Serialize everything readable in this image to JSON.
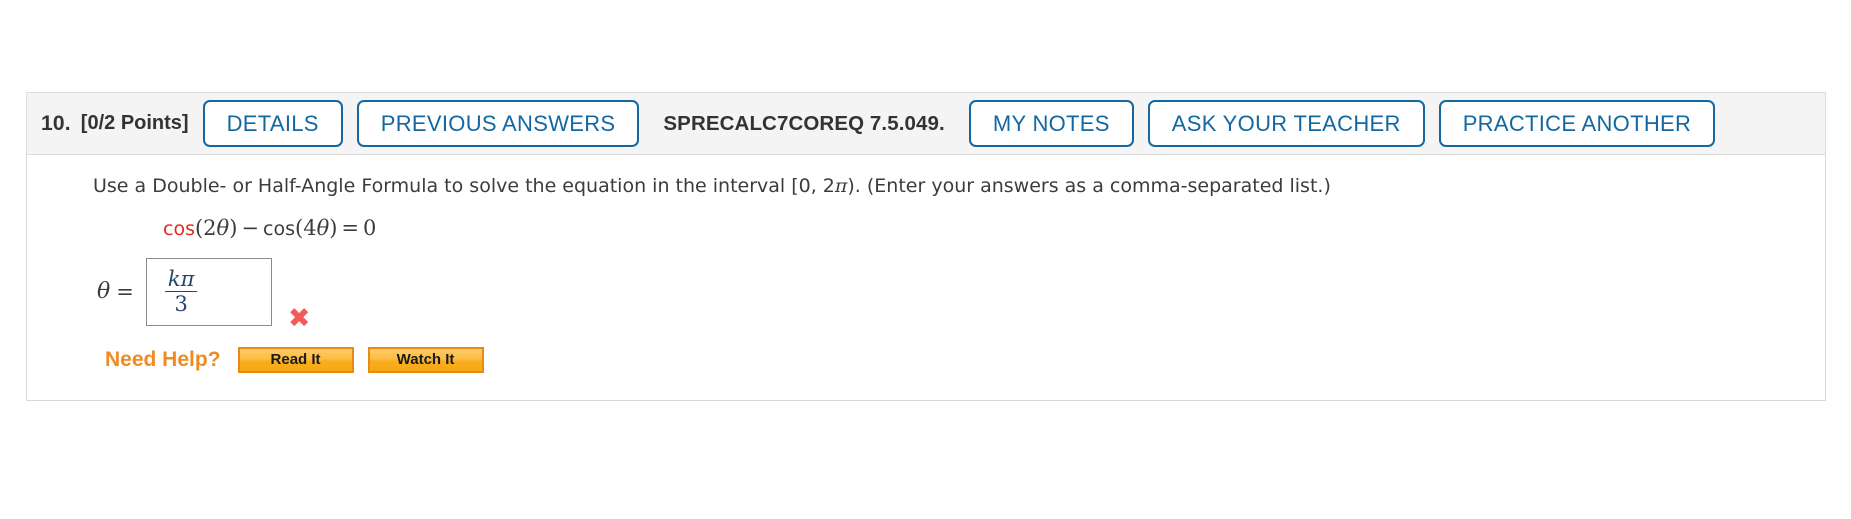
{
  "header": {
    "number": "10.",
    "points": "[0/2 Points]",
    "details_label": "DETAILS",
    "previous_answers_label": "PREVIOUS ANSWERS",
    "exercise_id": "SPRECALC7COREQ 7.5.049.",
    "my_notes_label": "MY NOTES",
    "ask_teacher_label": "ASK YOUR TEACHER",
    "practice_another_label": "PRACTICE ANOTHER",
    "accent_color": "#1368a2",
    "background_color": "#f4f4f4"
  },
  "body": {
    "prompt_part1": "Use a Double- or Half-Angle Formula to solve the equation in the interval [0, 2",
    "prompt_pi": "π",
    "prompt_part2": "). (Enter your answers as a comma-separated list.)",
    "equation": {
      "fn1": "cos",
      "arg1_open": "(2",
      "arg1_var": "θ",
      "arg1_close": ")",
      "operator": "−",
      "fn2": "cos",
      "arg2_open": "(4",
      "arg2_var": "θ",
      "arg2_close": ")",
      "equals": "=",
      "rhs": "0",
      "fn1_color": "#e02b20"
    },
    "answer": {
      "variable": "θ",
      "equals": "=",
      "numerator": "kπ",
      "denominator": "3",
      "status_icon": "x-mark-incorrect",
      "status_glyph": "✖",
      "status_color": "#f15b5b"
    },
    "need_help": {
      "label": "Need Help?",
      "label_color": "#ef8b22",
      "read_it_label": "Read It",
      "watch_it_label": "Watch It"
    }
  }
}
